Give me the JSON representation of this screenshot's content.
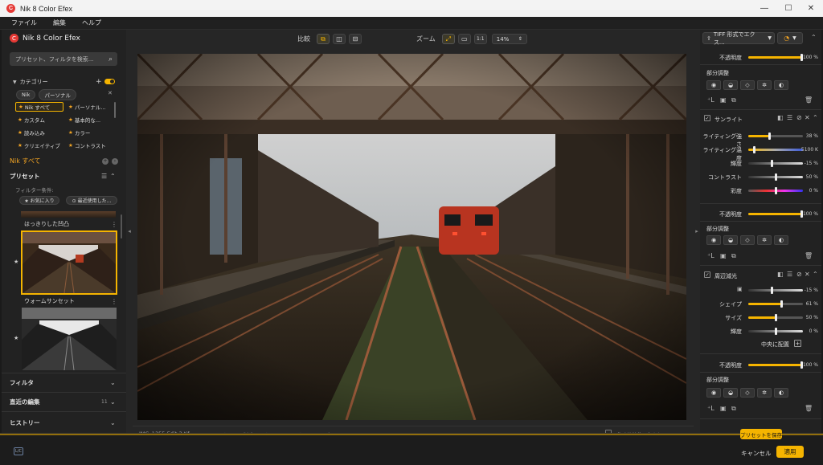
{
  "window": {
    "title": "Nik 8 Color Efex",
    "minimize": "—",
    "maximize": "☐",
    "close": "✕"
  },
  "menu": [
    "ファイル",
    "編集",
    "ヘルプ"
  ],
  "left": {
    "app_name": "Nik 8 Color Efex",
    "search_placeholder": "プリセット、フィルタを検索...",
    "category_label": "カテゴリー",
    "chips": [
      "Nik",
      "パーソナル"
    ],
    "filters": [
      {
        "label": "Nik すべて",
        "star": true,
        "selected": true
      },
      {
        "label": "パーソナル...",
        "star": true,
        "selected": false
      },
      {
        "label": "カスタム",
        "star": true,
        "selected": false
      },
      {
        "label": "基本的な...",
        "star": true,
        "selected": false
      },
      {
        "label": "読み込み",
        "star": true,
        "selected": false
      },
      {
        "label": "カラー",
        "star": true,
        "selected": false
      },
      {
        "label": "クリエイティブ",
        "star": true,
        "selected": false
      },
      {
        "label": "コントラスト",
        "star": true,
        "selected": false
      }
    ],
    "active_filter": "Nik すべて",
    "presets_label": "プリセット",
    "filter_condition_label": "フィルター条件:",
    "fav_button": "★ お気に入り",
    "recent_button": "⊙ 最近使用した...",
    "preset_items": [
      {
        "name": "はっきりした凹凸"
      },
      {
        "name": "ウォームサンセット"
      },
      {
        "name": ""
      }
    ],
    "sections": [
      {
        "label": "フィルタ",
        "count": ""
      },
      {
        "label": "直近の編集",
        "count": "11"
      },
      {
        "label": "ヒストリー",
        "count": ""
      }
    ]
  },
  "toolbar": {
    "compare_label": "比較",
    "zoom_label": "ズーム",
    "zoom_one": "1:1",
    "zoom_value": "14%"
  },
  "status": {
    "filename": "IMG_1355-Edit-3.tif",
    "info": "ISO: 640, カメラの製造メーカー: Canon, カメラのモデル: Canon EOS R5",
    "nondestructive_label": "非破壊編集 (大きなファイル)"
  },
  "right": {
    "export_label": "TIFF 形式でエクス...",
    "blocks": [
      {
        "opacity_label": "不透明度",
        "opacity_value": "100 %",
        "opacity": 1.0,
        "partial_label": "部分調整"
      },
      {
        "filter_name": "サンライト",
        "sliders": [
          {
            "label": "ライティング強さ",
            "value": "38 %",
            "level": 0.38,
            "kind": "gold"
          },
          {
            "label": "ライティング温度",
            "value": "5100 K",
            "level": 0.1,
            "kind": "temp"
          },
          {
            "label": "輝度",
            "value": "-15 %",
            "level": 0.42,
            "kind": "gray"
          },
          {
            "label": "コントラスト",
            "value": "50 %",
            "level": 0.5,
            "kind": "gray"
          },
          {
            "label": "彩度",
            "value": "0 %",
            "level": 0.5,
            "kind": "hue"
          }
        ],
        "opacity_label": "不透明度",
        "opacity_value": "100 %",
        "opacity": 1.0,
        "partial_label": "部分調整"
      },
      {
        "filter_name": "周辺減光",
        "sliders": [
          {
            "label": "",
            "value": "-15 %",
            "level": 0.42,
            "kind": "gray"
          },
          {
            "label": "シェイプ",
            "value": "61 %",
            "level": 0.61,
            "kind": "gold"
          },
          {
            "label": "サイズ",
            "value": "50 %",
            "level": 0.5,
            "kind": "gold"
          },
          {
            "label": "輝度",
            "value": "0 %",
            "level": 0.5,
            "kind": "gray"
          }
        ],
        "center_label": "中央に配置",
        "opacity_label": "不透明度",
        "opacity_value": "100 %",
        "opacity": 1.0,
        "partial_label": "部分調整"
      }
    ],
    "save_preset": "プリセットを保存"
  },
  "bottom": {
    "lc_label": "L/C",
    "cancel": "キャンセル",
    "apply": "適用"
  },
  "colors": {
    "accent": "#f5b400",
    "bg": "#222222",
    "panel": "#262626"
  }
}
